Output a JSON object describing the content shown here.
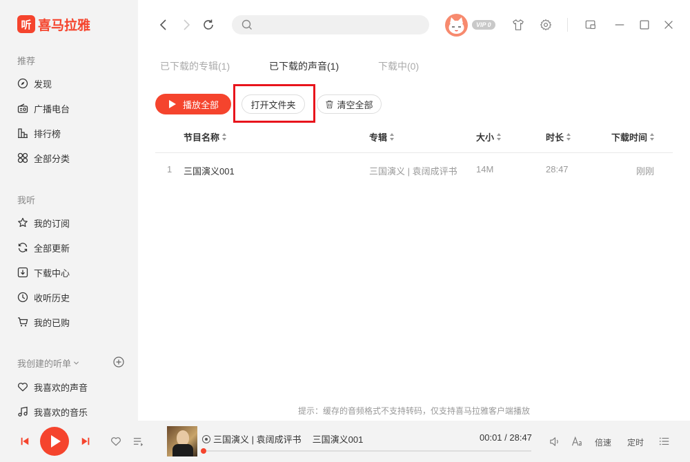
{
  "brand": {
    "mark": "听",
    "name": "喜马拉雅"
  },
  "sidebar": {
    "sec_recommend": "推荐",
    "recommend_items": [
      {
        "label": "发现",
        "icon": "compass-icon"
      },
      {
        "label": "广播电台",
        "icon": "radio-icon"
      },
      {
        "label": "排行榜",
        "icon": "chart-icon"
      },
      {
        "label": "全部分类",
        "icon": "grid-icon"
      }
    ],
    "sec_mine": "我听",
    "mine_items": [
      {
        "label": "我的订阅",
        "icon": "star-icon"
      },
      {
        "label": "全部更新",
        "icon": "refresh-icon"
      },
      {
        "label": "下载中心",
        "icon": "download-icon"
      },
      {
        "label": "收听历史",
        "icon": "clock-icon"
      },
      {
        "label": "我的已购",
        "icon": "cart-icon"
      }
    ],
    "sec_playlists": "我创建的听单",
    "playlist_items": [
      {
        "label": "我喜欢的声音",
        "icon": "heart-icon"
      },
      {
        "label": "我喜欢的音乐",
        "icon": "music-note-icon"
      }
    ]
  },
  "topbar": {
    "search_placeholder": "",
    "vip_badge": "VIP 0"
  },
  "tabs": [
    {
      "label": "已下载的专辑(1)",
      "active": false
    },
    {
      "label": "已下载的声音(1)",
      "active": true
    },
    {
      "label": "下载中(0)",
      "active": false
    }
  ],
  "actions": {
    "play_all": "播放全部",
    "open_folder": "打开文件夹",
    "clear_all": "清空全部"
  },
  "table": {
    "headers": {
      "name": "节目名称",
      "album": "专辑",
      "size": "大小",
      "duration": "时长",
      "time": "下载时间"
    },
    "rows": [
      {
        "index": "1",
        "name": "三国演义001",
        "album": "三国演义 | 袁阔成评书",
        "size": "14M",
        "duration": "28:47",
        "time": "刚刚"
      }
    ]
  },
  "hint": "提示：缓存的音频格式不支持转码，仅支持喜马拉雅客户端播放",
  "player": {
    "track_album": "三国演义 | 袁阔成评书",
    "track_title": "三国演义001",
    "time_display": "00:01 / 28:47",
    "progress_fraction": 0.0006,
    "speed_label": "倍速",
    "timer_label": "定时"
  },
  "colors": {
    "accent": "#f5442d",
    "highlight_box": "#e8141c"
  }
}
